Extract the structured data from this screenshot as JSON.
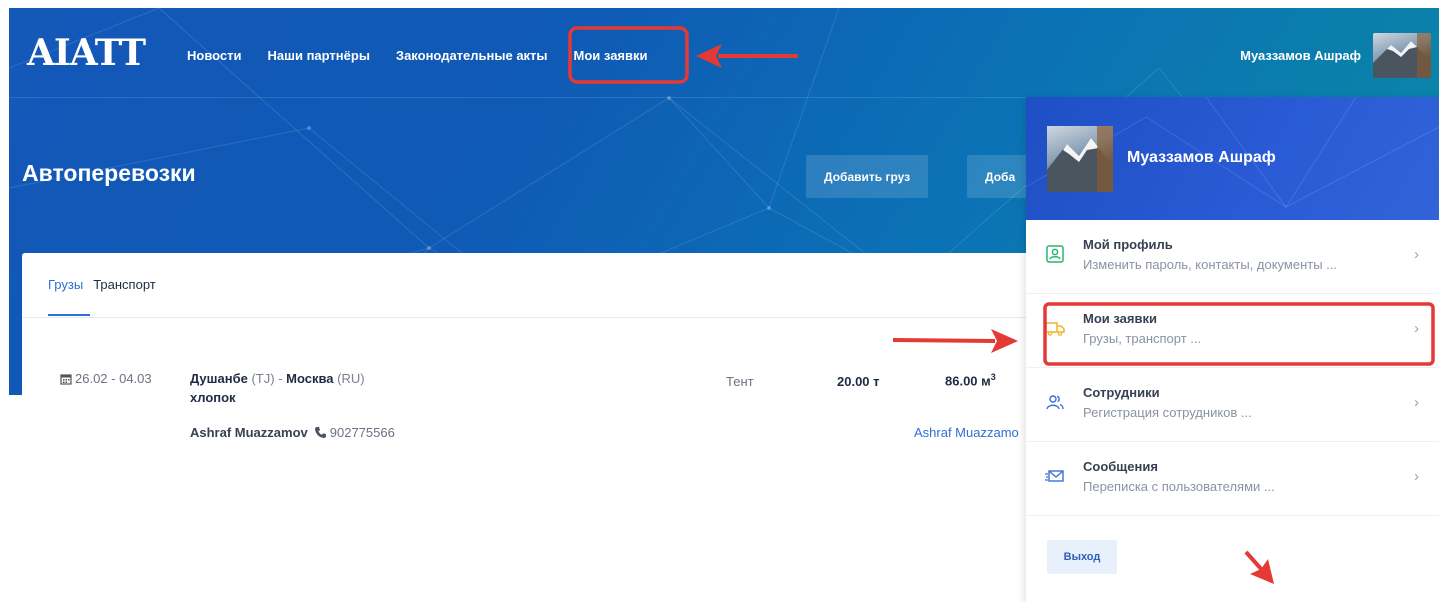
{
  "brand": {
    "logo": "AIATT"
  },
  "nav": {
    "items": [
      "Новости",
      "Наши партнёры",
      "Законодательные акты",
      "Мои заявки"
    ]
  },
  "header": {
    "user_name": "Муаззамов Ашраф"
  },
  "page": {
    "title": "Автоперевозки",
    "add_cargo_label": "Добавить груз",
    "add_transport_label": "Доба"
  },
  "tabs": {
    "cargo": "Грузы",
    "transport": "Транспорт"
  },
  "listing": {
    "date": "26.02 - 04.03",
    "from_city": "Душанбе",
    "from_cc": "(TJ)",
    "sep": "-",
    "to_city": "Москва",
    "to_cc": "(RU)",
    "goods": "хлопок",
    "contact_name": "Ashraf Muazzamov",
    "phone": "902775566",
    "body_type": "Тент",
    "weight": "20.00 т",
    "volume": "86.00 м",
    "volume_sup": "3",
    "owner_link": "Ashraf Muazzamo"
  },
  "panel": {
    "name": "Муаззамов Ашраф",
    "items": [
      {
        "title": "Мой профиль",
        "subtitle": "Изменить пароль, контакты, документы ...",
        "icon": "profile-icon"
      },
      {
        "title": "Мои заявки",
        "subtitle": "Грузы, транспорт ...",
        "icon": "truck-icon"
      },
      {
        "title": "Сотрудники",
        "subtitle": "Регистрация сотрудников ...",
        "icon": "employees-icon"
      },
      {
        "title": "Сообщения",
        "subtitle": "Переписка с пользователями ...",
        "icon": "envelope-icon"
      }
    ],
    "logout": "Выход"
  },
  "colors": {
    "accent": "#2f6fd6",
    "highlight": "#e53935",
    "panel_header": "#2a5bd6"
  }
}
